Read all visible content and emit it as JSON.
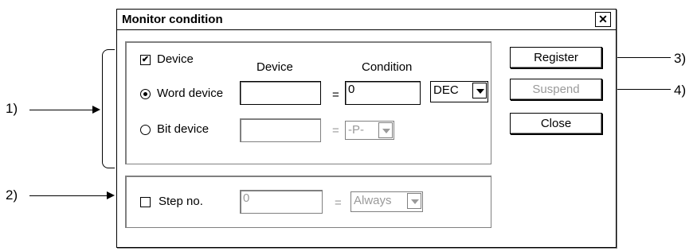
{
  "dialog": {
    "title": "Monitor condition",
    "close_symbol": "✕"
  },
  "device_group": {
    "device_checkbox": {
      "label": "Device",
      "checked": true,
      "mark": "✔"
    },
    "column_headers": {
      "device": "Device",
      "condition": "Condition"
    },
    "word_device": {
      "label": "Word device",
      "selected": true,
      "device_value": "",
      "equals": "=",
      "condition_value": "0",
      "radix": "DEC"
    },
    "bit_device": {
      "label": "Bit device",
      "selected": false,
      "device_value": "",
      "equals": "=",
      "condition_value": "-P-"
    }
  },
  "step_group": {
    "step_checkbox": {
      "label": "Step no.",
      "checked": false
    },
    "step_value": "0",
    "equals": "=",
    "condition_value": "Always"
  },
  "buttons": {
    "register": {
      "label": "Register",
      "enabled": true
    },
    "suspend": {
      "label": "Suspend",
      "enabled": false
    },
    "close": {
      "label": "Close",
      "enabled": true
    }
  },
  "callouts": {
    "c1": "1)",
    "c2": "2)",
    "c3": "3)",
    "c4": "4)"
  },
  "icons": [
    "close-icon",
    "checkmark-icon",
    "radio-dot-icon",
    "dropdown-arrow-icon"
  ]
}
